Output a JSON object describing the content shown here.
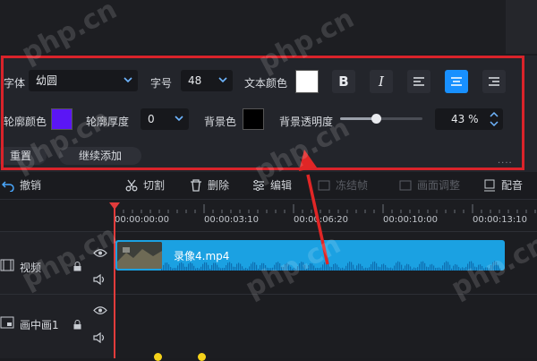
{
  "style_panel": {
    "font_label": "字体",
    "font_value": "幼圆",
    "size_label": "字号",
    "size_value": "48",
    "text_color_label": "文本颜色",
    "text_color": "#ffffff",
    "bold_icon": "B",
    "italic_icon": "I",
    "outline_color_label": "轮廓颜色",
    "outline_color": "#5b16f5",
    "outline_thickness_label": "轮廓厚度",
    "outline_thickness_value": "0",
    "bg_color_label": "背景色",
    "bg_color": "#000000",
    "bg_opacity_label": "背景透明度",
    "bg_opacity_value": "43 %",
    "bg_opacity_fraction": 0.43,
    "reset_label": "重置",
    "continue_add_label": "继续添加",
    "align_active": "center",
    "more_icon": "...."
  },
  "toolbar": {
    "undo_label": "撤销",
    "cut_label": "切割",
    "delete_label": "删除",
    "edit_label": "编辑",
    "freeze_label": "冻结帧",
    "adjust_label": "画面调整",
    "export_label": "配音"
  },
  "timeline": {
    "ticks": [
      "00:00:00:00",
      "00:00:03:10",
      "00:00:06:20",
      "00:00:10:00",
      "00:00:13:10"
    ],
    "tracks": [
      {
        "label": "视频",
        "icon": "film-icon"
      },
      {
        "label": "画中画1",
        "icon": "pip-icon"
      }
    ],
    "clip_name": "录像4.mp4"
  },
  "watermark": "php.cn",
  "colors": {
    "accent": "#1890ff",
    "clip": "#1ba1e2",
    "highlight": "#d9232a",
    "panel_bg": "#23252b"
  }
}
